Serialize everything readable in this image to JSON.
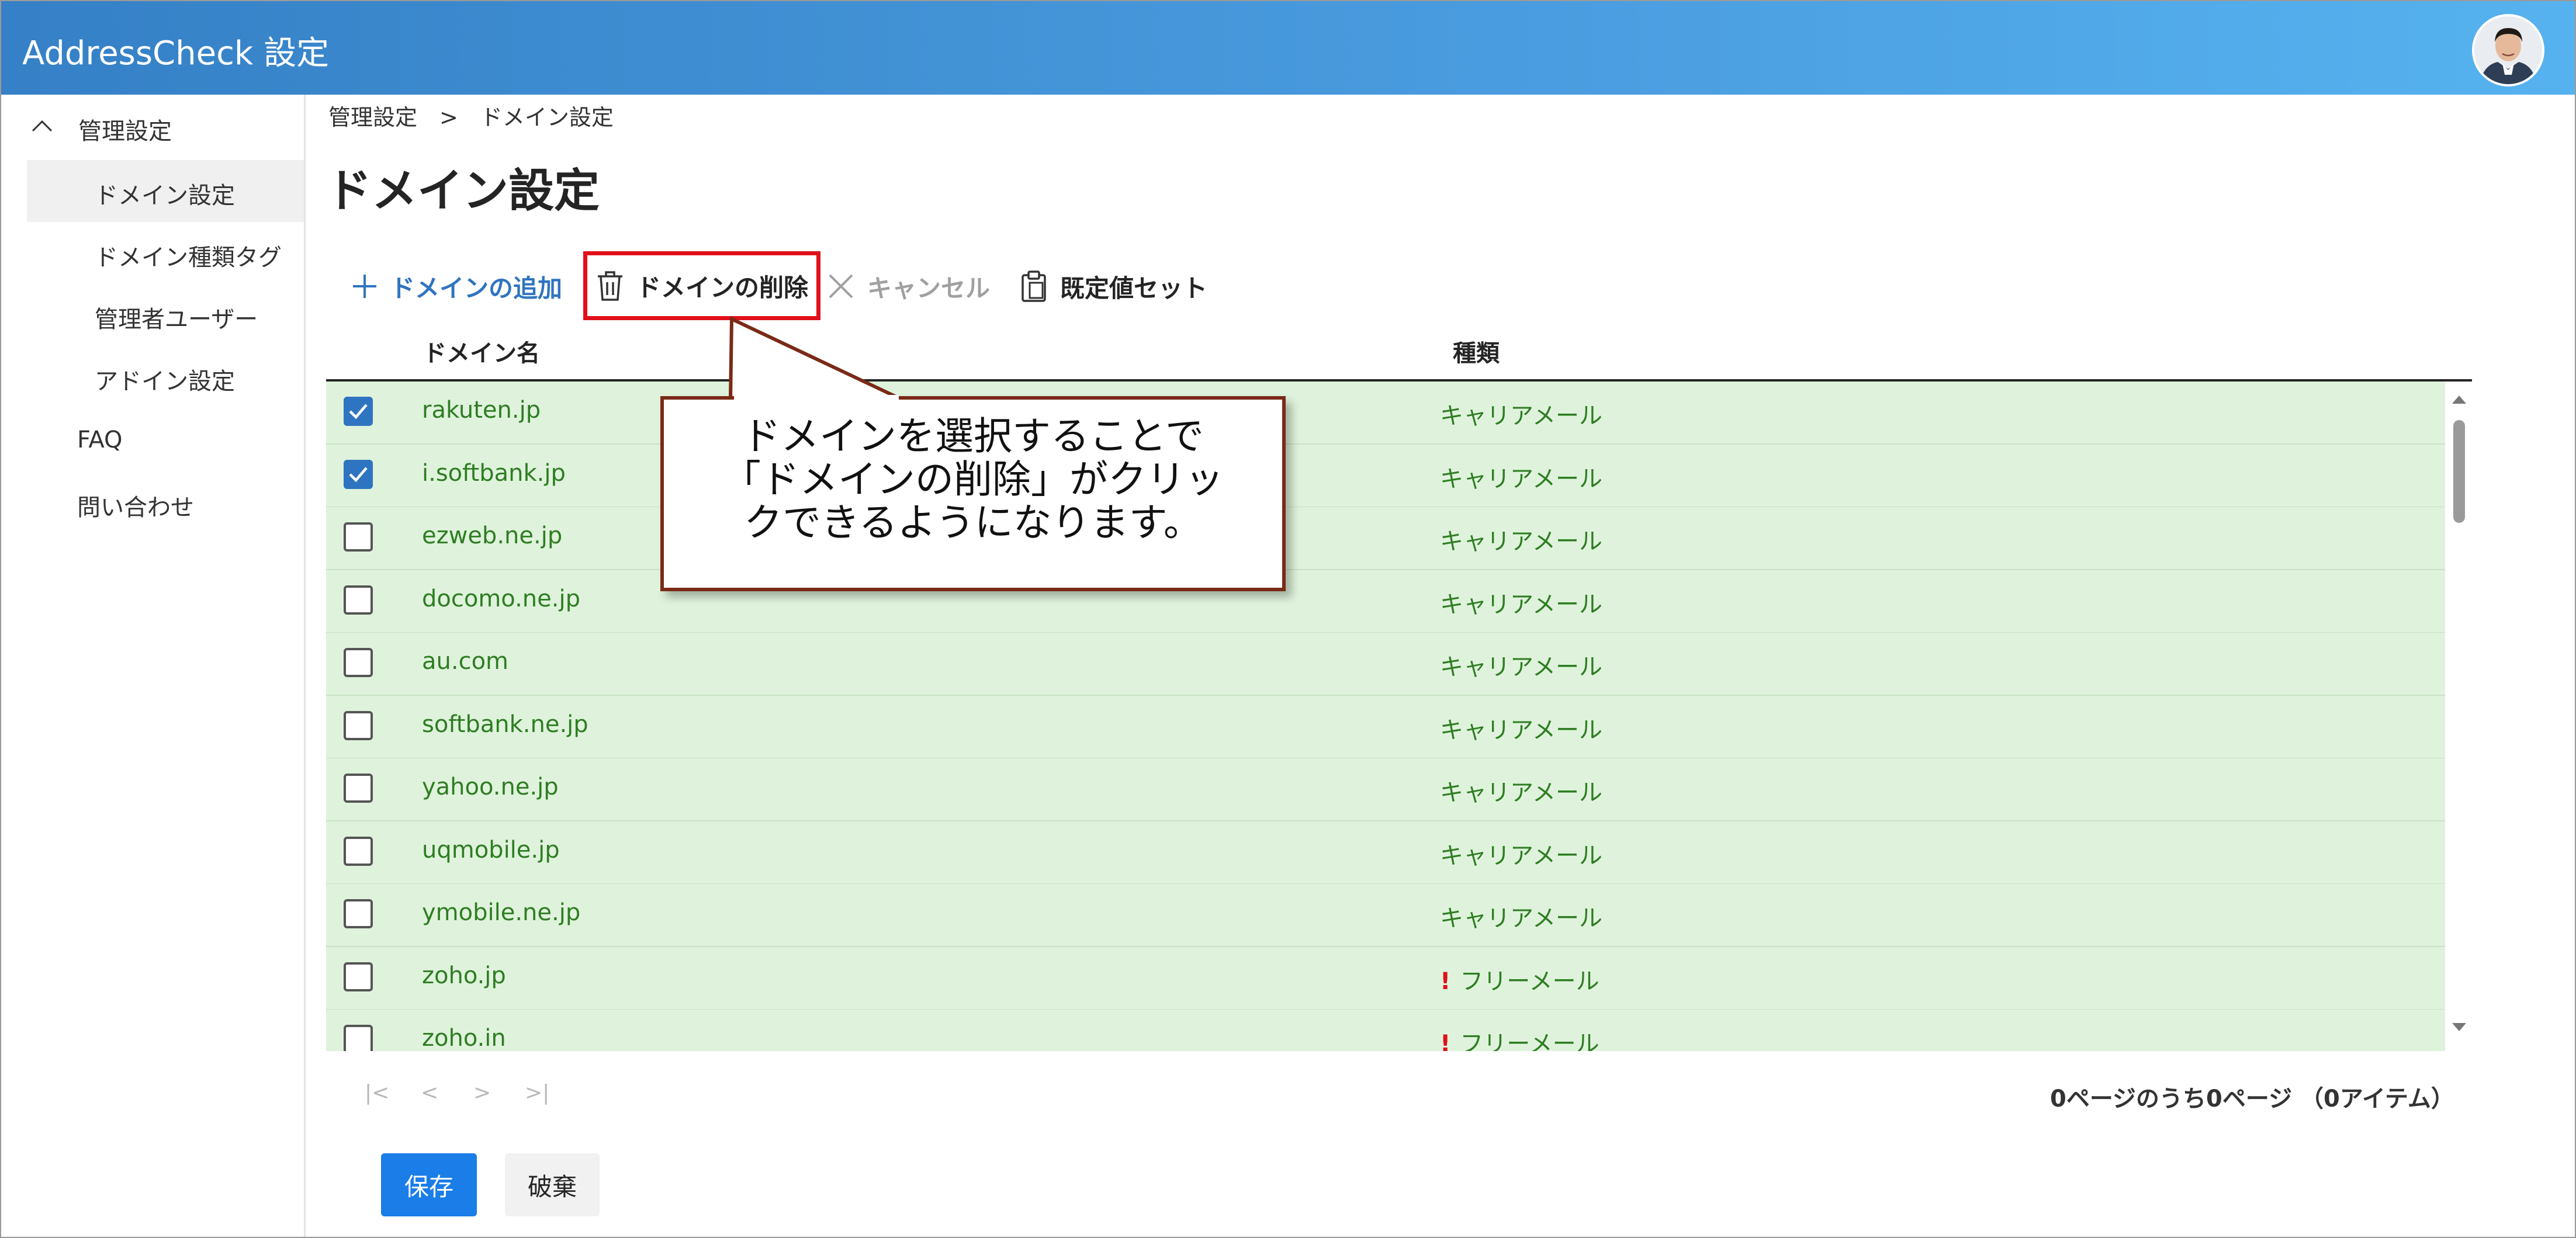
{
  "app": {
    "title": "AddressCheck 設定"
  },
  "sidebar": {
    "group": "管理設定",
    "items": [
      {
        "label": "ドメイン設定",
        "selected": true
      },
      {
        "label": "ドメイン種類タグ"
      },
      {
        "label": "管理者ユーザー"
      },
      {
        "label": "アドイン設定"
      }
    ],
    "faq": "FAQ",
    "contact": "問い合わせ"
  },
  "breadcrumb": {
    "root": "管理設定",
    "separator": ">",
    "current": "ドメイン設定"
  },
  "page": {
    "title": "ドメイン設定"
  },
  "toolbar": {
    "add_label": "ドメインの追加",
    "delete_label": "ドメインの削除",
    "cancel_label": "キャンセル",
    "default_label": "既定値セット",
    "highlight_color": "#e0101a"
  },
  "table": {
    "columns": [
      "ドメイン名",
      "種類"
    ],
    "rows": [
      {
        "checked": true,
        "domain": "rakuten.jp",
        "type": "キャリアメール",
        "warning": false
      },
      {
        "checked": true,
        "domain": "i.softbank.jp",
        "type": "キャリアメール",
        "warning": false
      },
      {
        "checked": false,
        "domain": "ezweb.ne.jp",
        "type": "キャリアメール",
        "warning": false
      },
      {
        "checked": false,
        "domain": "docomo.ne.jp",
        "type": "キャリアメール",
        "warning": false
      },
      {
        "checked": false,
        "domain": "au.com",
        "type": "キャリアメール",
        "warning": false
      },
      {
        "checked": false,
        "domain": "softbank.ne.jp",
        "type": "キャリアメール",
        "warning": false
      },
      {
        "checked": false,
        "domain": "yahoo.ne.jp",
        "type": "キャリアメール",
        "warning": false
      },
      {
        "checked": false,
        "domain": "uqmobile.jp",
        "type": "キャリアメール",
        "warning": false
      },
      {
        "checked": false,
        "domain": "ymobile.ne.jp",
        "type": "キャリアメール",
        "warning": false
      },
      {
        "checked": false,
        "domain": "zoho.jp",
        "type": "フリーメール",
        "warning": true
      },
      {
        "checked": false,
        "domain": "zoho.in",
        "type": "フリーメール",
        "warning": true
      }
    ],
    "warning_mark": "!",
    "row_color": "#dff3dc",
    "text_color": "#2e7d22"
  },
  "pager": {
    "first": "|<",
    "prev": "<",
    "next": ">",
    "last": ">|",
    "status": "0ページのうち0ページ （0アイテム）"
  },
  "actions": {
    "save_label": "保存",
    "discard_label": "破棄"
  },
  "callout": {
    "lines": [
      "ドメインを選択することで",
      "「ドメインの削除」がクリッ",
      "クできるようになります。"
    ],
    "border_color": "#7a2a17"
  }
}
